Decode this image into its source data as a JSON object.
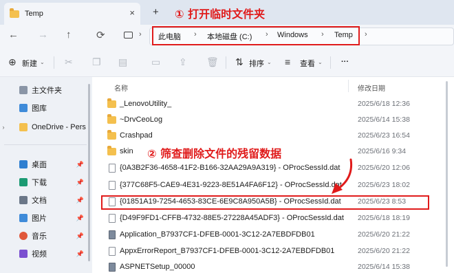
{
  "window": {
    "tab_title": "Temp",
    "tab_close_icon": "×",
    "new_tab_icon": "+"
  },
  "annotations": {
    "step1": "① 打开临时文件夹",
    "step2": "② 筛查删除文件的残留数据",
    "color": "#e01b1b"
  },
  "nav": {
    "back_icon": "←",
    "forward_icon": "→",
    "up_icon": "↑",
    "refresh_icon": "⟳",
    "breadcrumb": [
      "此电脑",
      "本地磁盘 (C:)",
      "Windows",
      "Temp"
    ],
    "separator": "›"
  },
  "toolbar": {
    "new_label": "新建",
    "sort_label": "排序",
    "view_label": "查看",
    "more_label": "···"
  },
  "sidebar": {
    "items": [
      {
        "label": "主文件夹",
        "icon": "home-icon"
      },
      {
        "label": "图库",
        "icon": "gallery-icon"
      },
      {
        "label": "OneDrive - Pers",
        "icon": "onedrive-folder-icon"
      },
      {
        "label": "桌面",
        "icon": "desktop-icon"
      },
      {
        "label": "下载",
        "icon": "download-icon"
      },
      {
        "label": "文档",
        "icon": "documents-icon"
      },
      {
        "label": "图片",
        "icon": "pictures-icon"
      },
      {
        "label": "音乐",
        "icon": "music-icon"
      },
      {
        "label": "视频",
        "icon": "videos-icon"
      }
    ]
  },
  "files": {
    "col_name": "名称",
    "col_date": "修改日期",
    "rows": [
      {
        "name": "_LenovoUtility_",
        "date": "2025/6/18 12:36",
        "type": "folder"
      },
      {
        "name": "~DrvCeoLog",
        "date": "2025/6/14 15:38",
        "type": "folder"
      },
      {
        "name": "Crashpad",
        "date": "2025/6/23 16:54",
        "type": "folder"
      },
      {
        "name": "skin",
        "date": "2025/6/16 9:34",
        "type": "folder"
      },
      {
        "name": "{0A3B2F36-4658-41F2-B166-32AA29A9A319} - OProcSessId.dat",
        "date": "2025/6/20 12:06",
        "type": "file"
      },
      {
        "name": "{377C68F5-CAE9-4E31-9223-8E51A4FA6F12} - OProcSessId.dat",
        "date": "2025/6/23 18:02",
        "type": "file"
      },
      {
        "name": "{01851A19-7254-4653-83CE-6E9C8A950A5B} - OProcSessId.dat",
        "date": "2025/6/23 8:53",
        "type": "file"
      },
      {
        "name": "{D49F9FD1-CFFB-4732-88E5-27228A45ADF3} - OProcSessId.dat",
        "date": "2025/6/18 18:19",
        "type": "file"
      },
      {
        "name": "Application_B7937CF1-DFEB-0001-3C12-2A7EBDFDB01",
        "date": "2025/6/20 21:22",
        "type": "exe"
      },
      {
        "name": "AppxErrorReport_B7937CF1-DFEB-0001-3C12-2A7EBDFDB01",
        "date": "2025/6/20 21:22",
        "type": "file"
      },
      {
        "name": "ASPNETSetup_00000",
        "date": "2025/6/14 15:38",
        "type": "exe"
      }
    ]
  }
}
